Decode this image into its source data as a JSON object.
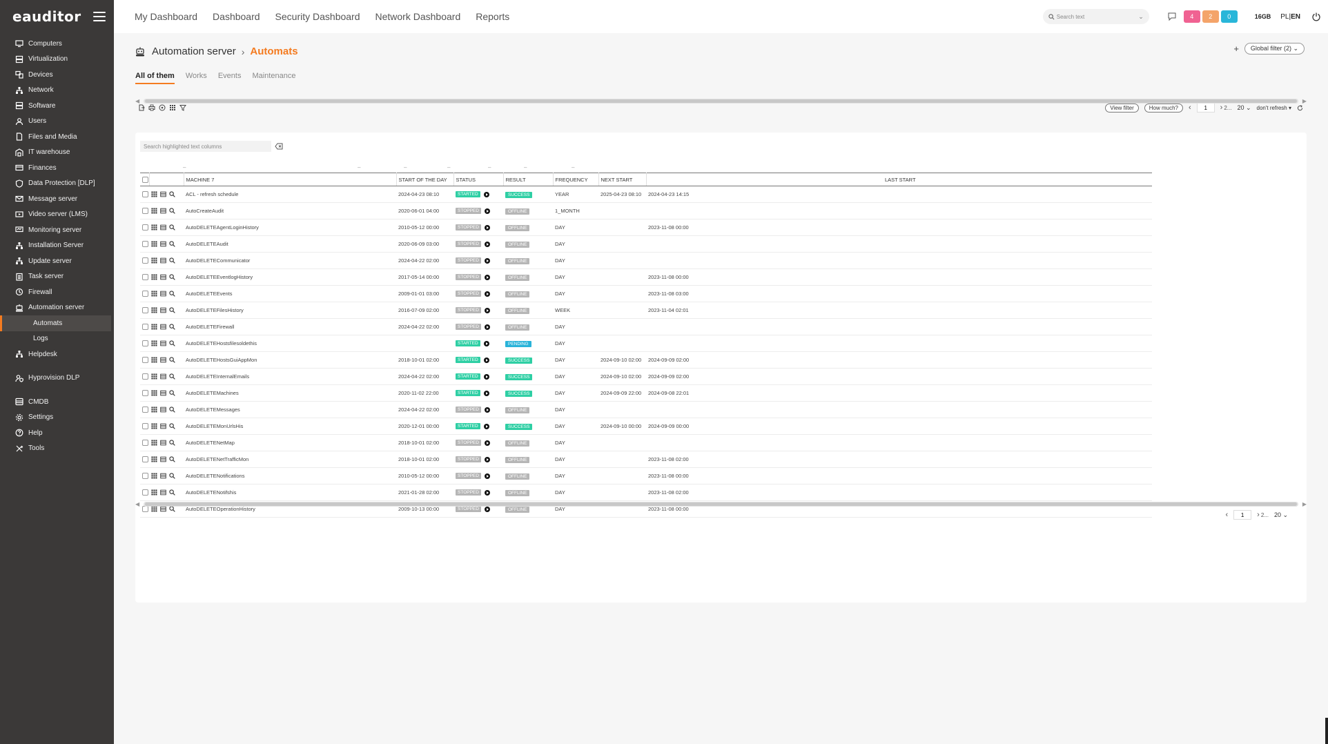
{
  "app": {
    "logo": "eauditor"
  },
  "sidebar": {
    "items": [
      {
        "label": "Computers",
        "icon": "monitor-icon"
      },
      {
        "label": "Virtualization",
        "icon": "server-icon"
      },
      {
        "label": "Devices",
        "icon": "devices-icon"
      },
      {
        "label": "Network",
        "icon": "network-icon"
      },
      {
        "label": "Software",
        "icon": "software-icon"
      },
      {
        "label": "Users",
        "icon": "users-icon"
      },
      {
        "label": "Files and Media",
        "icon": "file-icon"
      },
      {
        "label": "IT warehouse",
        "icon": "warehouse-icon"
      },
      {
        "label": "Finances",
        "icon": "finances-icon"
      },
      {
        "label": "Data Protection [DLP]",
        "icon": "shield-icon"
      },
      {
        "label": "Message server",
        "icon": "mail-icon"
      },
      {
        "label": "Video server (LMS)",
        "icon": "video-icon"
      },
      {
        "label": "Monitoring server",
        "icon": "monitor-server-icon"
      },
      {
        "label": "Installation Server",
        "icon": "install-icon"
      },
      {
        "label": "Update server",
        "icon": "update-icon"
      },
      {
        "label": "Task server",
        "icon": "task-icon"
      },
      {
        "label": "Firewall",
        "icon": "firewall-icon"
      },
      {
        "label": "Automation server",
        "icon": "robot-icon"
      }
    ],
    "sub_items": [
      {
        "label": "Automats"
      },
      {
        "label": "Logs"
      }
    ],
    "items_after": [
      {
        "label": "Helpdesk",
        "icon": "helpdesk-icon"
      }
    ],
    "group2": [
      {
        "label": "Hyprovision DLP",
        "icon": "user-shield-icon"
      }
    ],
    "group3": [
      {
        "label": "CMDB",
        "icon": "database-icon"
      },
      {
        "label": "Settings",
        "icon": "gear-icon"
      },
      {
        "label": "Help",
        "icon": "help-icon"
      },
      {
        "label": "Tools",
        "icon": "tools-icon"
      }
    ]
  },
  "topnav": [
    "My Dashboard",
    "Dashboard",
    "Security Dashboard",
    "Network Dashboard",
    "Reports"
  ],
  "topbar": {
    "search_placeholder": "Search text",
    "badges": [
      {
        "value": "4",
        "color": "#f06292"
      },
      {
        "value": "2",
        "color": "#f4a46a"
      },
      {
        "value": "0",
        "color": "#29b6d9"
      }
    ],
    "memory": "16GB",
    "lang_pl": "PL",
    "lang_sep": "|",
    "lang_en": "EN"
  },
  "breadcrumb": {
    "parent": "Automation server",
    "current": "Automats"
  },
  "global_filter": {
    "plus": "+",
    "label": "Global filter (2)"
  },
  "tabs": [
    "All of them",
    "Works",
    "Events",
    "Maintenance"
  ],
  "toolbar": {
    "view_filter": "View filter",
    "how_much": "How much?",
    "page": "1",
    "page_next": "2...",
    "per_page": "20",
    "refresh": "don't refresh"
  },
  "table": {
    "search_placeholder": "Search highlighted text columns",
    "columns": {
      "machine": "MACHINE",
      "machine_sort": "7",
      "start_of_day": "START OF THE DAY",
      "status": "STATUS",
      "result": "RESULT",
      "frequency": "FREQUENCY",
      "next_start": "NEXT START",
      "last_start": "LAST START"
    },
    "rows": [
      {
        "name": "ACL - refresh schedule",
        "start": "2024-04-23 08:10",
        "status": "STARTED",
        "result": "SUCCESS",
        "freq": "YEAR",
        "next": "2025-04-23 08:10",
        "last": "2024-04-23 14:15"
      },
      {
        "name": "AutoCreateAudit",
        "start": "2020-06-01 04:00",
        "status": "STOPPED",
        "result": "OFFLINE",
        "freq": "1_MONTH",
        "next": "",
        "last": ""
      },
      {
        "name": "AutoDELETEAgentLoginHistory",
        "start": "2010-05-12 00:00",
        "status": "STOPPED",
        "result": "OFFLINE",
        "freq": "DAY",
        "next": "",
        "last": "2023-11-08 00:00"
      },
      {
        "name": "AutoDELETEAudit",
        "start": "2020-06-09 03:00",
        "status": "STOPPED",
        "result": "OFFLINE",
        "freq": "DAY",
        "next": "",
        "last": ""
      },
      {
        "name": "AutoDELETECommunicator",
        "start": "2024-04-22 02:00",
        "status": "STOPPED",
        "result": "OFFLINE",
        "freq": "DAY",
        "next": "",
        "last": ""
      },
      {
        "name": "AutoDELETEEventlogHistory",
        "start": "2017-05-14 00:00",
        "status": "STOPPED",
        "result": "OFFLINE",
        "freq": "DAY",
        "next": "",
        "last": "2023-11-08 00:00"
      },
      {
        "name": "AutoDELETEEvents",
        "start": "2009-01-01 03:00",
        "status": "STOPPED",
        "result": "OFFLINE",
        "freq": "DAY",
        "next": "",
        "last": "2023-11-08 03:00"
      },
      {
        "name": "AutoDELETEFilesHistory",
        "start": "2016-07-09 02:00",
        "status": "STOPPED",
        "result": "OFFLINE",
        "freq": "WEEK",
        "next": "",
        "last": "2023-11-04 02:01"
      },
      {
        "name": "AutoDELETEFirewall",
        "start": "2024-04-22 02:00",
        "status": "STOPPED",
        "result": "OFFLINE",
        "freq": "DAY",
        "next": "",
        "last": ""
      },
      {
        "name": "AutoDELETEHostsfilesoldethis",
        "start": "",
        "status": "STARTED",
        "result": "PENDING",
        "freq": "DAY",
        "next": "",
        "last": ""
      },
      {
        "name": "AutoDELETEHostsGuiAppMon",
        "start": "2018-10-01 02:00",
        "status": "STARTED",
        "result": "SUCCESS",
        "freq": "DAY",
        "next": "2024-09-10 02:00",
        "last": "2024-09-09 02:00"
      },
      {
        "name": "AutoDELETEInternalEmails",
        "start": "2024-04-22 02:00",
        "status": "STARTED",
        "result": "SUCCESS",
        "freq": "DAY",
        "next": "2024-09-10 02:00",
        "last": "2024-09-09 02:00"
      },
      {
        "name": "AutoDELETEMachines",
        "start": "2020-11-02 22:00",
        "status": "STARTED",
        "result": "SUCCESS",
        "freq": "DAY",
        "next": "2024-09-09 22:00",
        "last": "2024-09-08 22:01"
      },
      {
        "name": "AutoDELETEMessages",
        "start": "2024-04-22 02:00",
        "status": "STOPPED",
        "result": "OFFLINE",
        "freq": "DAY",
        "next": "",
        "last": ""
      },
      {
        "name": "AutoDELETEMonUrlsHis",
        "start": "2020-12-01 00:00",
        "status": "STARTED",
        "result": "SUCCESS",
        "freq": "DAY",
        "next": "2024-09-10 00:00",
        "last": "2024-09-09 00:00"
      },
      {
        "name": "AutoDELETENetMap",
        "start": "2018-10-01 02:00",
        "status": "STOPPED",
        "result": "OFFLINE",
        "freq": "DAY",
        "next": "",
        "last": ""
      },
      {
        "name": "AutoDELETENetTrafficMon",
        "start": "2018-10-01 02:00",
        "status": "STOPPED",
        "result": "OFFLINE",
        "freq": "DAY",
        "next": "",
        "last": "2023-11-08 02:00"
      },
      {
        "name": "AutoDELETENotifications",
        "start": "2010-05-12 00:00",
        "status": "STOPPED",
        "result": "OFFLINE",
        "freq": "DAY",
        "next": "",
        "last": "2023-11-08 00:00"
      },
      {
        "name": "AutoDELETENotifshis",
        "start": "2021-01-28 02:00",
        "status": "STOPPED",
        "result": "OFFLINE",
        "freq": "DAY",
        "next": "",
        "last": "2023-11-08 02:00"
      },
      {
        "name": "AutoDELETEOperationHistory",
        "start": "2009-10-13 00:00",
        "status": "STOPPED",
        "result": "OFFLINE",
        "freq": "DAY",
        "next": "",
        "last": "2023-11-08 00:00"
      }
    ]
  },
  "bottom_pager": {
    "page": "1",
    "page_next": "2...",
    "per_page": "20"
  },
  "colors": {
    "accent": "#f47b20",
    "sidebar_bg": "#3b3938",
    "success": "#2ecfa4",
    "offline": "#b6b6b6",
    "pending": "#29b3d9"
  }
}
